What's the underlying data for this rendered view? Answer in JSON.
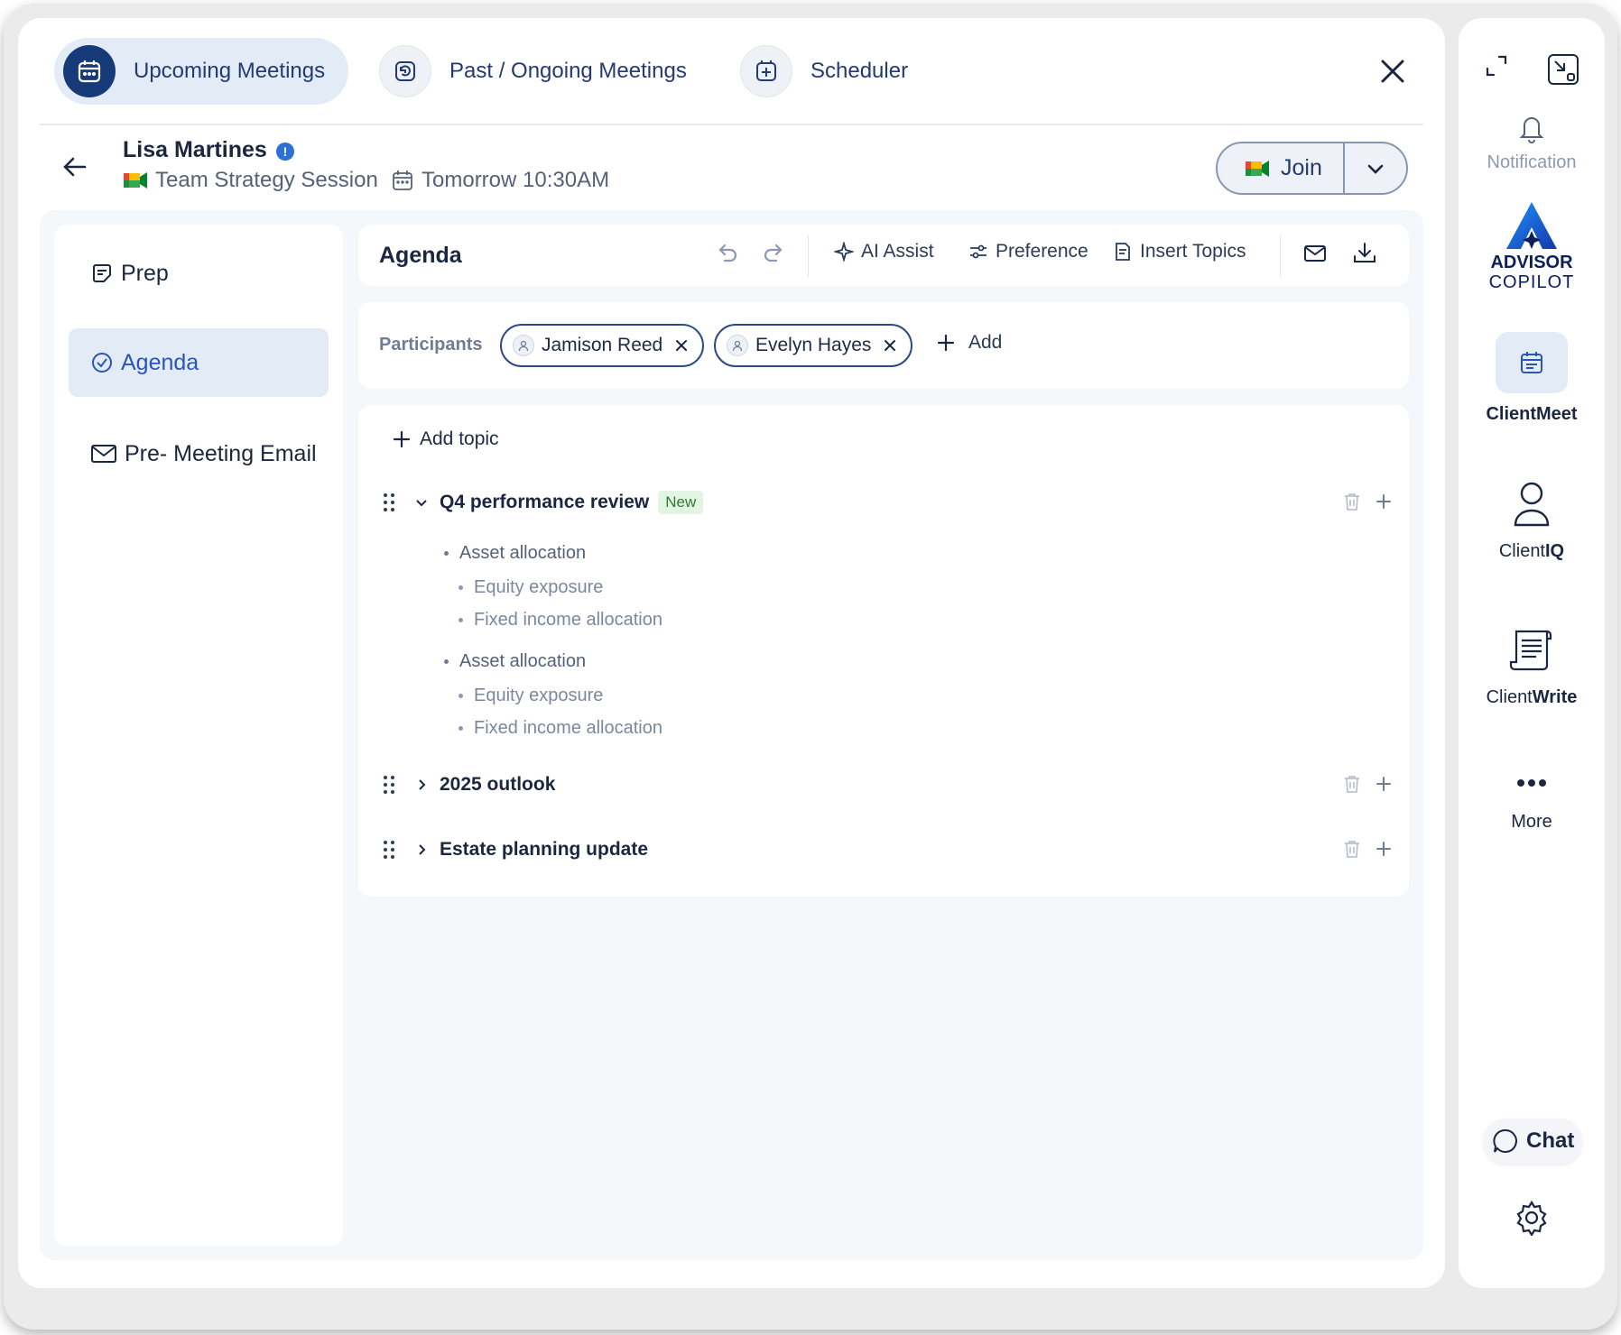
{
  "tabs": [
    {
      "label": "Upcoming Meetings",
      "active": true
    },
    {
      "label": "Past / Ongoing Meetings",
      "active": false
    },
    {
      "label": "Scheduler",
      "active": false
    }
  ],
  "header": {
    "client_name": "Lisa Martines",
    "info_badge": "!",
    "meeting_type": "Team Strategy Session",
    "meeting_time": "Tomorrow 10:30AM",
    "join_label": "Join"
  },
  "left_nav": [
    {
      "label": "Prep",
      "icon": "note-icon",
      "active": false
    },
    {
      "label": "Agenda",
      "icon": "check-circle-icon",
      "active": true
    },
    {
      "label": "Pre- Meeting Email",
      "icon": "mail-icon",
      "active": false
    }
  ],
  "toolbar": {
    "title": "Agenda",
    "ai_assist": "AI Assist",
    "preference": "Preference",
    "insert_topics": "Insert Topics"
  },
  "participants": {
    "label": "Participants",
    "people": [
      "Jamison Reed",
      "Evelyn Hayes"
    ],
    "add_label": "Add"
  },
  "agenda": {
    "add_topic": "Add topic",
    "topics": [
      {
        "title": "Q4 performance review",
        "badge": "New",
        "expanded": true,
        "groups": [
          {
            "item": "Asset allocation",
            "subitems": [
              "Equity exposure",
              "Fixed income allocation"
            ]
          },
          {
            "item": "Asset allocation",
            "subitems": [
              "Equity exposure",
              "Fixed income allocation"
            ]
          }
        ]
      },
      {
        "title": "2025 outlook",
        "expanded": false
      },
      {
        "title": "Estate planning update",
        "expanded": false
      }
    ]
  },
  "rail": {
    "notification": "Notification",
    "brand_line1": "ADVISOR",
    "brand_line2": "COPILOT",
    "clientmeet": "ClientMeet",
    "clientiq_a": "Client",
    "clientiq_b": "IQ",
    "clientwrite_a": "Client",
    "clientwrite_b": "Write",
    "more": "More",
    "chat": "Chat"
  },
  "colors": {
    "accent": "#173a78",
    "active_bg": "#e3ebf7",
    "badge_green": "#2e7d32"
  }
}
